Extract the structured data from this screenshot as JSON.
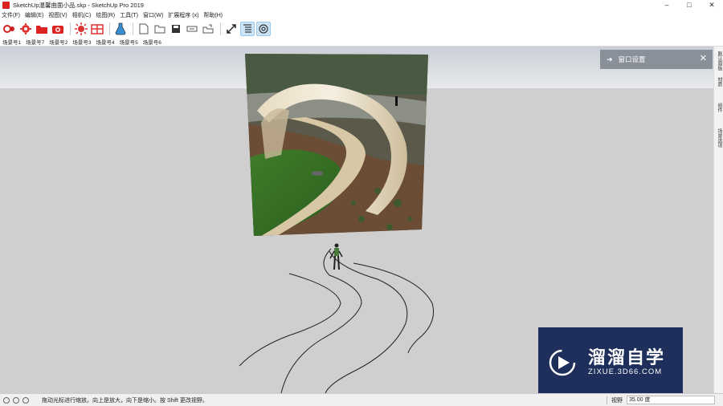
{
  "window": {
    "title": "SketchUp温馨曲面小品.skp - SketchUp Pro 2019",
    "minimize": "–",
    "maximize": "□",
    "close": "✕"
  },
  "menu": [
    "文件(F)",
    "编辑(E)",
    "视图(V)",
    "相机(C)",
    "绘图(R)",
    "工具(T)",
    "窗口(W)",
    "扩展程序 (x)",
    "帮助(H)"
  ],
  "toolbar": {
    "icons": [
      "select-tool-icon",
      "gear-tool-icon",
      "folder-red-icon",
      "camera-red-icon",
      "sun-settings-icon",
      "grid-icon",
      "flask-icon",
      "new-file-icon",
      "open-folder-icon",
      "save-icon",
      "send-icon",
      "export-icon",
      "zoom-extents-icon",
      "layers-icon",
      "settings-icon"
    ]
  },
  "scenes": [
    "场景号1",
    "场景号7",
    "场景号2",
    "场景号3",
    "场景号4",
    "场景号5",
    "场景号6"
  ],
  "right_tray": {
    "tabs": [
      "默认面板",
      "材质",
      "组件",
      "场景选项"
    ]
  },
  "panel": {
    "arrow": "➜",
    "title": "窗口设置",
    "close": "✕"
  },
  "status": {
    "icons": [
      "geo-location-icon",
      "credits-icon",
      "help-icon"
    ],
    "hint": "拖动光标进行缩放。向上是放大，向下是缩小。按 Shift 更改视野。",
    "measure_label": "视野",
    "measure_value": "35.00 度"
  },
  "watermark": {
    "name": "溜溜自学",
    "url": "ZIXUE.3D66.COM"
  },
  "colors": {
    "ground": "#cfcfcf",
    "panel_header": "#8a9099",
    "watermark_bg": "#1d2f5a"
  }
}
